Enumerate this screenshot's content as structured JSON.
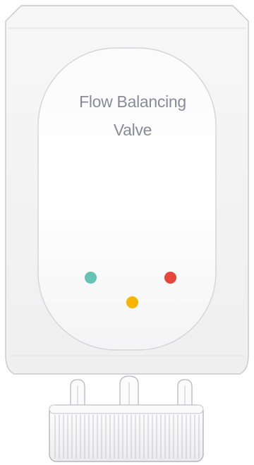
{
  "device": {
    "label_line_1": "Flow Balancing",
    "label_line_2": "Valve",
    "body_color": "#f6f6f6",
    "outline_color": "#c9c9cc",
    "face_color": "#ffffff"
  },
  "indicators": [
    {
      "name": "green",
      "color": "#66c2b2"
    },
    {
      "name": "yellow",
      "color": "#f7b500"
    },
    {
      "name": "red",
      "color": "#e8453c"
    }
  ]
}
